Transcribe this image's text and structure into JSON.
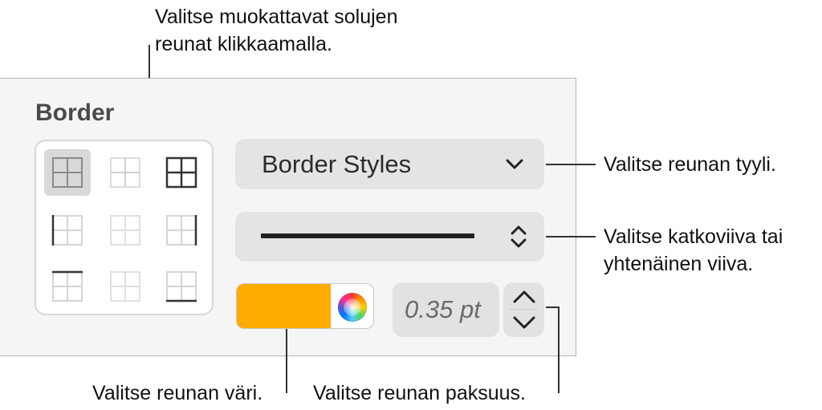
{
  "callouts": {
    "top_line1": "Valitse muokattavat solujen",
    "top_line2": "reunat klikkaamalla.",
    "style": "Valitse reunan tyyli.",
    "dash_line1": "Valitse katkoviiva tai",
    "dash_line2": "yhtenäinen viiva.",
    "color": "Valitse reunan väri.",
    "thickness": "Valitse reunan paksuus."
  },
  "panel": {
    "section_title": "Border",
    "border_styles_label": "Border Styles",
    "line_style": "solid",
    "color": "#ffab00",
    "thickness_value": "0.35 pt"
  },
  "colors": {
    "panel_bg": "#f5f5f5",
    "popup_bg": "#e4e4e4",
    "border_color_swatch": "#ffab00"
  },
  "border_grid": [
    {
      "name": "border-all-inner-outer-selected",
      "selected": true
    },
    {
      "name": "border-inner"
    },
    {
      "name": "border-outer-all"
    },
    {
      "name": "border-left"
    },
    {
      "name": "border-none-center"
    },
    {
      "name": "border-right"
    },
    {
      "name": "border-top"
    },
    {
      "name": "border-none"
    },
    {
      "name": "border-bottom"
    }
  ]
}
